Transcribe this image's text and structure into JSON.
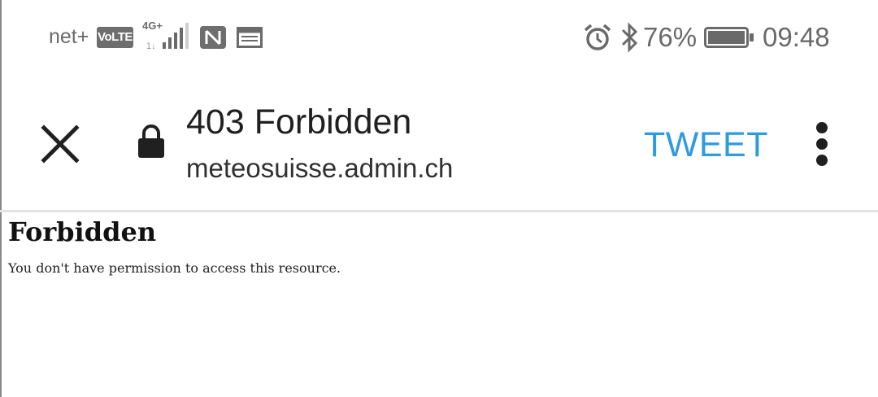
{
  "status_bar": {
    "carrier": "net+",
    "volte": "VoLTE",
    "network_type": "4G+",
    "icons": [
      "signal-icon",
      "nfc-icon",
      "calendar-icon",
      "alarm-icon",
      "bluetooth-icon",
      "battery-icon"
    ],
    "battery_percent": "76%",
    "battery_level": 0.76,
    "time": "09:48"
  },
  "toolbar": {
    "close_icon": "close-icon",
    "lock_icon": "lock-icon",
    "title": "403 Forbidden",
    "domain": "meteosuisse.admin.ch",
    "tweet_label": "TWEET",
    "tweet_color": "#2c9be0",
    "menu_icon": "more-vert-icon"
  },
  "page": {
    "heading": "Forbidden",
    "message": "You don't have permission to access this resource."
  }
}
